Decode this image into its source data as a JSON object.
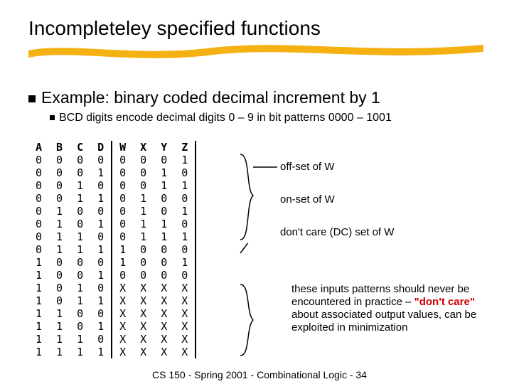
{
  "title": "Incompleteley specified functions",
  "bullet1": "Example: binary coded decimal increment by 1",
  "bullet2": "BCD digits encode decimal digits 0 – 9 in bit patterns 0000 – 1001",
  "table": {
    "headers": [
      "A",
      "B",
      "C",
      "D",
      "W",
      "X",
      "Y",
      "Z"
    ],
    "rows": [
      [
        "0",
        "0",
        "0",
        "0",
        "0",
        "0",
        "0",
        "1"
      ],
      [
        "0",
        "0",
        "0",
        "1",
        "0",
        "0",
        "1",
        "0"
      ],
      [
        "0",
        "0",
        "1",
        "0",
        "0",
        "0",
        "1",
        "1"
      ],
      [
        "0",
        "0",
        "1",
        "1",
        "0",
        "1",
        "0",
        "0"
      ],
      [
        "0",
        "1",
        "0",
        "0",
        "0",
        "1",
        "0",
        "1"
      ],
      [
        "0",
        "1",
        "0",
        "1",
        "0",
        "1",
        "1",
        "0"
      ],
      [
        "0",
        "1",
        "1",
        "0",
        "0",
        "1",
        "1",
        "1"
      ],
      [
        "0",
        "1",
        "1",
        "1",
        "1",
        "0",
        "0",
        "0"
      ],
      [
        "1",
        "0",
        "0",
        "0",
        "1",
        "0",
        "0",
        "1"
      ],
      [
        "1",
        "0",
        "0",
        "1",
        "0",
        "0",
        "0",
        "0"
      ],
      [
        "1",
        "0",
        "1",
        "0",
        "X",
        "X",
        "X",
        "X"
      ],
      [
        "1",
        "0",
        "1",
        "1",
        "X",
        "X",
        "X",
        "X"
      ],
      [
        "1",
        "1",
        "0",
        "0",
        "X",
        "X",
        "X",
        "X"
      ],
      [
        "1",
        "1",
        "0",
        "1",
        "X",
        "X",
        "X",
        "X"
      ],
      [
        "1",
        "1",
        "1",
        "0",
        "X",
        "X",
        "X",
        "X"
      ],
      [
        "1",
        "1",
        "1",
        "1",
        "X",
        "X",
        "X",
        "X"
      ]
    ]
  },
  "annot": {
    "offset": "off-set of W",
    "onset": "on-set of W",
    "dcset": "don't care (DC) set of W",
    "note_pre": "these inputs patterns should never be encountered in practice – ",
    "note_red": "\"don't care\"",
    "note_post": " about associated output values, can be exploited in minimization"
  },
  "footer": "CS 150 - Spring 2001 - Combinational Logic - 34"
}
